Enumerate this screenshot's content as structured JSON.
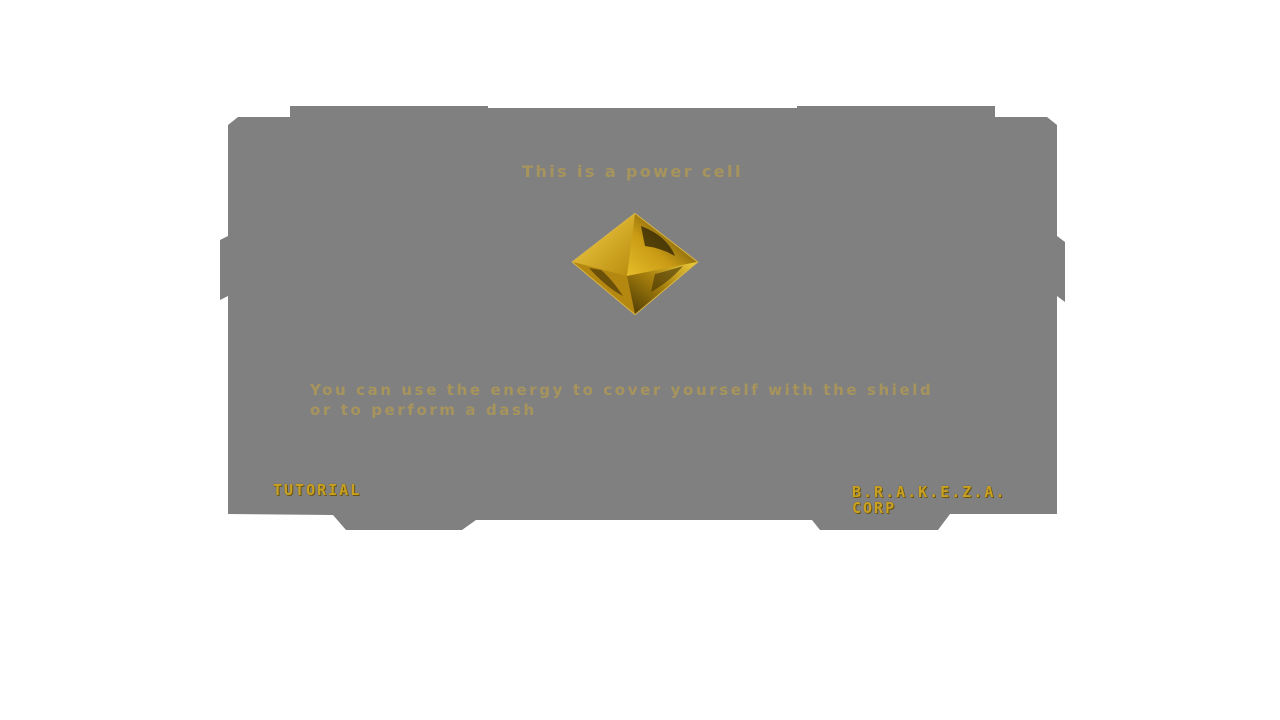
{
  "dialog": {
    "title": "This is a power cell",
    "body_lines": [
      "You can use the energy to cover yourself with the shield",
      "or to perform a dash"
    ],
    "footer_left": "TUTORIAL",
    "footer_right_line1": "B.R.A.K.E.Z.A.",
    "footer_right_line2": "CORP"
  },
  "item": {
    "name": "power-cell",
    "icon": "power-cell-icon"
  },
  "colors": {
    "page_background": "#ffffff",
    "panel": "#808080",
    "text_muted_gold": "#a6945c",
    "accent_gold": "#caa021"
  }
}
